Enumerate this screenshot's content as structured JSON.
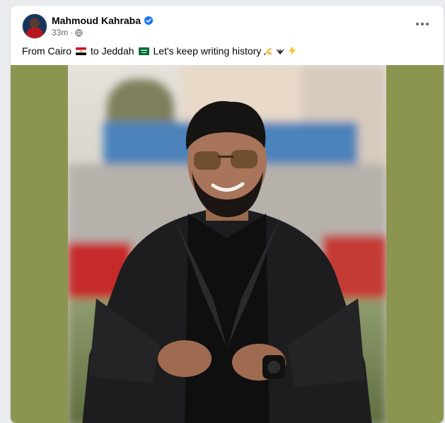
{
  "post": {
    "author": "Mahmoud Kahraba",
    "time": "33m",
    "caption": {
      "part1": "From Cairo",
      "part2": "to Jeddah",
      "part3": "Let's keep writing history"
    },
    "photo_alt": "Man in black blazer and sunglasses smiling on a football pitch"
  },
  "colors": {
    "link_blue": "#1877f2",
    "media_bg": "#8c9550",
    "text_primary": "#050505",
    "text_secondary": "#65676b"
  },
  "icons": [
    "verified-badge-icon",
    "globe-icon",
    "more-options-icon",
    "egypt-flag-icon",
    "saudi-flag-icon",
    "writing-hand-icon",
    "eagle-icon",
    "lightning-icon"
  ]
}
